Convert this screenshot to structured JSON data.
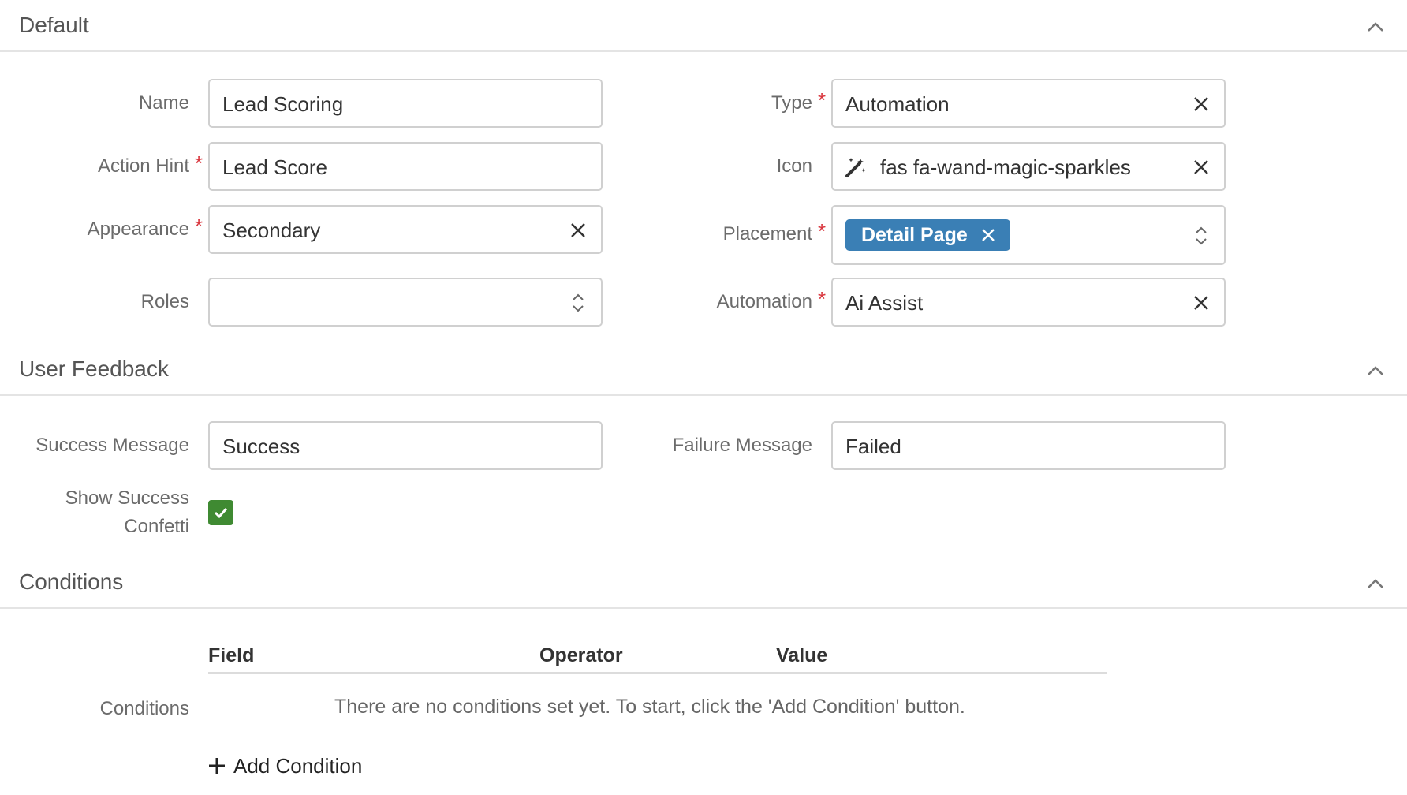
{
  "sections": {
    "default": {
      "title": "Default"
    },
    "user_feedback": {
      "title": "User Feedback"
    },
    "conditions": {
      "title": "Conditions"
    }
  },
  "default_fields": {
    "name": {
      "label": "Name",
      "value": "Lead Scoring"
    },
    "action_hint": {
      "label": "Action Hint",
      "value": "Lead Score",
      "required": "*"
    },
    "appearance": {
      "label": "Appearance",
      "value": "Secondary",
      "required": "*"
    },
    "roles": {
      "label": "Roles",
      "value": ""
    },
    "type": {
      "label": "Type",
      "value": "Automation",
      "required": "*"
    },
    "icon": {
      "label": "Icon",
      "value": "fas fa-wand-magic-sparkles",
      "icon_name": "wand-magic-sparkles-icon"
    },
    "placement": {
      "label": "Placement",
      "tag": "Detail Page",
      "required": "*"
    },
    "automation": {
      "label": "Automation",
      "value": "Ai Assist",
      "required": "*"
    }
  },
  "feedback_fields": {
    "success_message": {
      "label": "Success Message",
      "value": "Success"
    },
    "failure_message": {
      "label": "Failure Message",
      "value": "Failed"
    },
    "show_confetti": {
      "label_line1": "Show Success",
      "label_line2": "Confetti",
      "checked": true
    }
  },
  "conditions": {
    "label": "Conditions",
    "columns": [
      "Field",
      "Operator",
      "Value"
    ],
    "empty_message": "There are no conditions set yet. To start, click the 'Add Condition' button.",
    "add_button": "Add Condition"
  },
  "colors": {
    "accent": "#3a7fb5",
    "checkbox": "#3f8a32",
    "required": "#d9363e"
  }
}
